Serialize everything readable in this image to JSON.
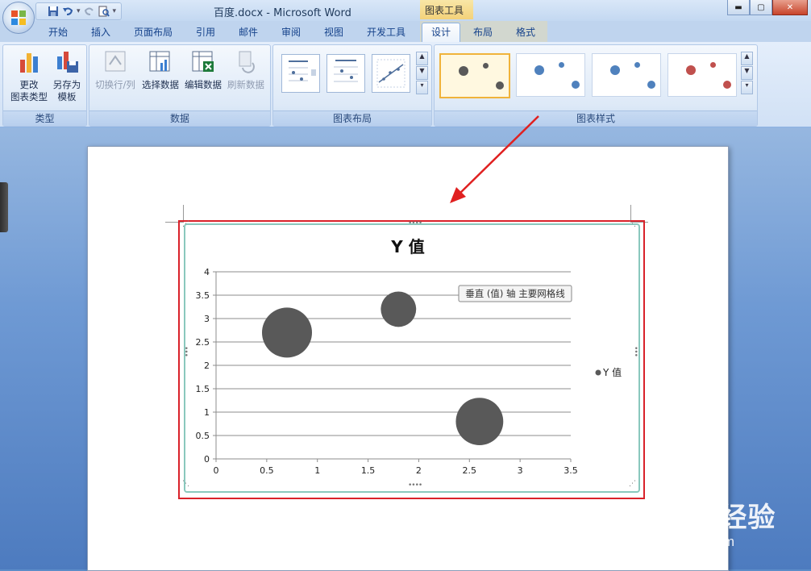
{
  "window": {
    "title": "百度.docx - Microsoft Word",
    "contextual_tab_group": "图表工具",
    "controls": {
      "minimize": "▬",
      "maximize": "▢",
      "close": "✕"
    }
  },
  "quick_access": [
    "save-icon",
    "undo-icon",
    "redo-icon",
    "print-preview-icon",
    "customize-icon"
  ],
  "tabs": [
    "开始",
    "插入",
    "页面布局",
    "引用",
    "邮件",
    "审阅",
    "视图",
    "开发工具",
    "设计",
    "布局",
    "格式"
  ],
  "active_tab": "设计",
  "ribbon": {
    "type_group": {
      "label": "类型",
      "change_type": [
        "更改",
        "图表类型"
      ],
      "save_template": [
        "另存为",
        "模板"
      ]
    },
    "data_group": {
      "label": "数据",
      "switch_row_col": "切换行/列",
      "select_data": "选择数据",
      "edit_data": "编辑数据",
      "refresh_data": "刷新数据"
    },
    "layout_group": {
      "label": "图表布局"
    },
    "style_group": {
      "label": "图表样式",
      "styles": [
        {
          "color": "#595959",
          "selected": true
        },
        {
          "color": "#4f81bd",
          "selected": false
        },
        {
          "color": "#4f81bd",
          "selected": false
        },
        {
          "color": "#c0504d",
          "selected": false
        }
      ]
    }
  },
  "chart_tooltip": "垂直 (值) 轴 主要网格线",
  "watermark": {
    "brand": "Bai du 经验",
    "url": "jingyan.baidu.com"
  },
  "colors": {
    "bubble": "#595959",
    "highlight_frame": "#d9222a",
    "arrow": "#e02020",
    "selection_border": "#8ac8bd"
  },
  "chart_data": {
    "type": "scatter",
    "title": "Y 值",
    "x_ticks": [
      "0",
      "0.5",
      "1",
      "1.5",
      "2",
      "2.5",
      "3",
      "3.5"
    ],
    "y_ticks": [
      "0",
      "0.5",
      "1",
      "1.5",
      "2",
      "2.5",
      "3",
      "3.5",
      "4"
    ],
    "xlim": [
      0,
      3.5
    ],
    "ylim": [
      0,
      4
    ],
    "grid": "horizontal major gridlines",
    "legend_position": "right",
    "series": [
      {
        "name": "Y 值",
        "x": [
          0.7,
          1.8,
          2.6
        ],
        "y": [
          2.7,
          3.2,
          0.8
        ],
        "size": [
          10,
          5,
          9
        ]
      }
    ]
  }
}
